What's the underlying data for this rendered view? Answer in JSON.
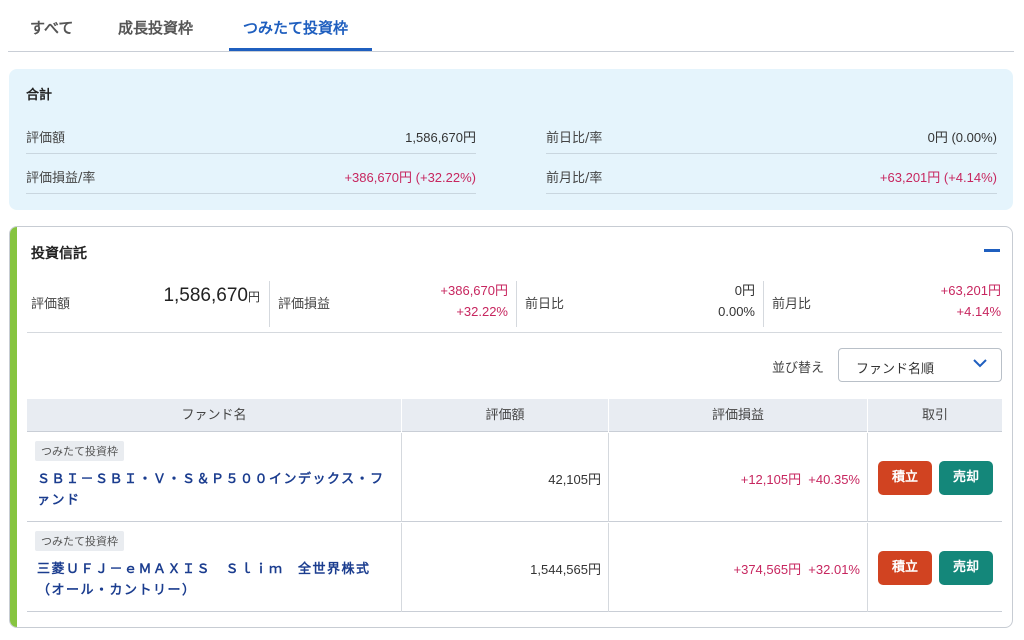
{
  "tabs": [
    {
      "label": "すべて"
    },
    {
      "label": "成長投資枠"
    },
    {
      "label": "つみたて投資枠"
    }
  ],
  "summary": {
    "title": "合計",
    "valuation_label": "評価額",
    "valuation_value": "1,586,670円",
    "day_change_label": "前日比/率",
    "day_change_value": "0円 (0.00%)",
    "pl_label": "評価損益/率",
    "pl_value": "+386,670円 (+32.22%)",
    "month_change_label": "前月比/率",
    "month_change_value": "+63,201円 (+4.14%)"
  },
  "fund_section": {
    "title": "投資信託",
    "valuation_label": "評価額",
    "valuation_value": "1,586,670",
    "valuation_unit": "円",
    "pl_label": "評価損益",
    "pl_amount": "+386,670円",
    "pl_rate": "+32.22%",
    "day_label": "前日比",
    "day_amount": "0円",
    "day_rate": "0.00%",
    "month_label": "前月比",
    "month_amount": "+63,201円",
    "month_rate": "+4.14%"
  },
  "sort": {
    "label": "並び替え",
    "selected": "ファンド名順"
  },
  "table": {
    "headers": [
      "ファンド名",
      "評価額",
      "評価損益",
      "取引"
    ],
    "rows": [
      {
        "badge": "つみたて投資枠",
        "name": "ＳＢＩ－ＳＢＩ・Ｖ・Ｓ＆Ｐ５００インデックス・ファンド",
        "valuation": "42,105円",
        "pl": "+12,105円  +40.35%",
        "buy_label": "積立",
        "sell_label": "売却"
      },
      {
        "badge": "つみたて投資枠",
        "name": "三菱ＵＦＪ－ｅＭＡＸＩＳ　Ｓｌｉｍ　全世界株式（オール・カントリー）",
        "valuation": "1,544,565円",
        "pl": "+374,565円  +32.01%",
        "buy_label": "積立",
        "sell_label": "売却"
      }
    ]
  },
  "colors": {
    "accent_blue": "#1f5fbf",
    "positive": "#c7265f",
    "buy_button": "#d14321",
    "sell_button": "#14877a",
    "section_accent": "#86c440",
    "summary_bg": "#e5f4fc"
  }
}
